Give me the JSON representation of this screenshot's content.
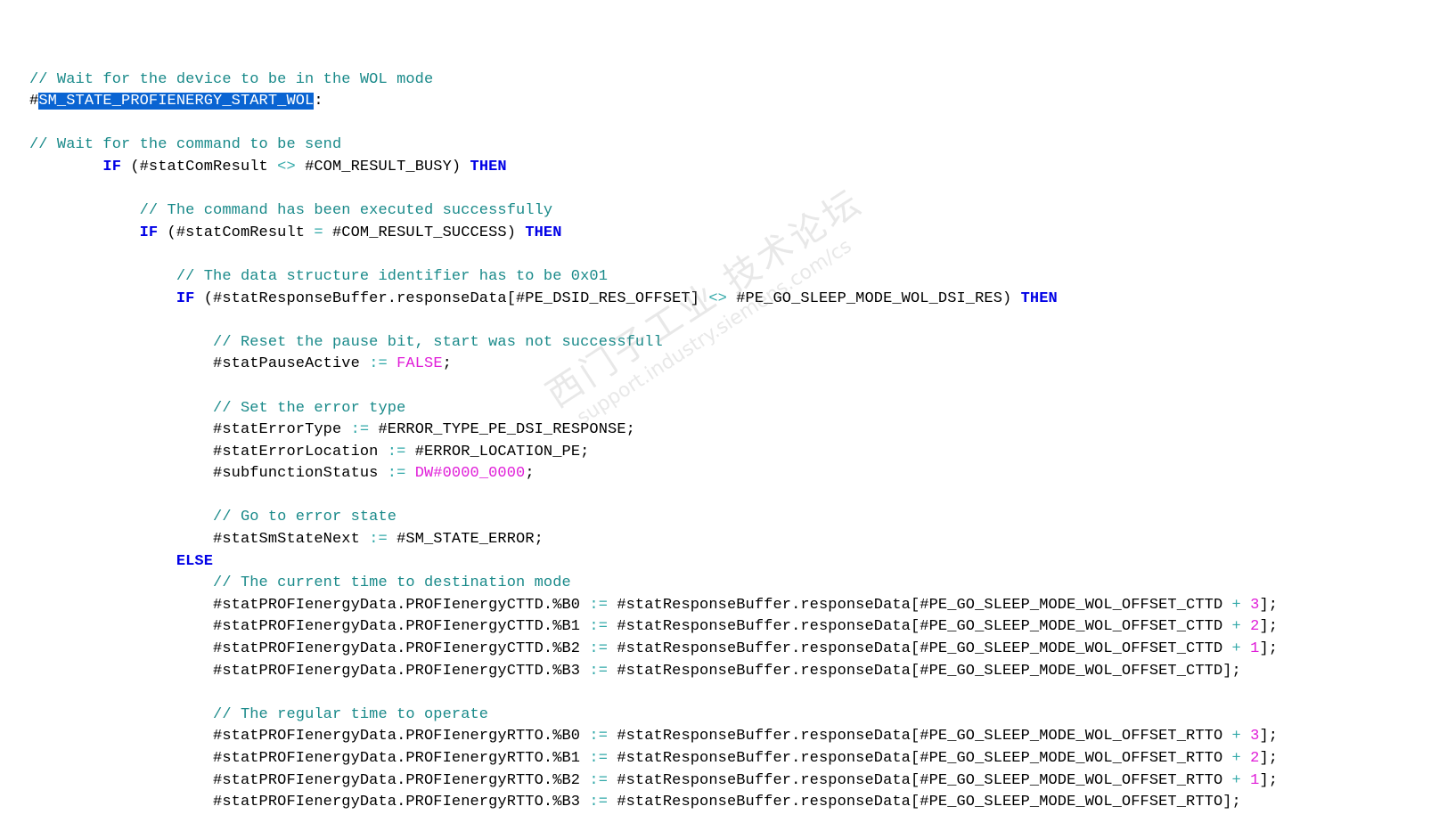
{
  "editor": {
    "lines": [
      {
        "indent": 0,
        "tokens": []
      },
      {
        "indent": 0,
        "tokens": [
          {
            "t": "// Wait for the device to be in the WOL mode",
            "c": "cm"
          }
        ]
      },
      {
        "indent": 0,
        "tokens": [
          {
            "t": "#",
            "c": "id"
          },
          {
            "t": "SM_STATE_PROFIENERGY_START_WOL",
            "c": "sel"
          },
          {
            "t": ":",
            "c": "id"
          }
        ]
      },
      {
        "indent": 0,
        "tokens": []
      },
      {
        "indent": 0,
        "tokens": [
          {
            "t": "// Wait for the command to be send",
            "c": "cm"
          }
        ]
      },
      {
        "indent": 8,
        "tokens": [
          {
            "t": "IF",
            "c": "kw"
          },
          {
            "t": " (#statComResult ",
            "c": "id"
          },
          {
            "t": "<>",
            "c": "op"
          },
          {
            "t": " #COM_RESULT_BUSY) ",
            "c": "id"
          },
          {
            "t": "THEN",
            "c": "kw"
          }
        ]
      },
      {
        "indent": 0,
        "tokens": []
      },
      {
        "indent": 12,
        "tokens": [
          {
            "t": "// The command has been executed successfully",
            "c": "cm"
          }
        ]
      },
      {
        "indent": 12,
        "tokens": [
          {
            "t": "IF",
            "c": "kw"
          },
          {
            "t": " (#statComResult ",
            "c": "id"
          },
          {
            "t": "=",
            "c": "op"
          },
          {
            "t": " #COM_RESULT_SUCCESS) ",
            "c": "id"
          },
          {
            "t": "THEN",
            "c": "kw"
          }
        ]
      },
      {
        "indent": 0,
        "tokens": []
      },
      {
        "indent": 16,
        "tokens": [
          {
            "t": "// The data structure identifier has to be 0x01",
            "c": "cm"
          }
        ]
      },
      {
        "indent": 16,
        "tokens": [
          {
            "t": "IF",
            "c": "kw"
          },
          {
            "t": " (#statResponseBuffer.responseData[#PE_DSID_RES_OFFSET] ",
            "c": "id"
          },
          {
            "t": "<>",
            "c": "op"
          },
          {
            "t": " #PE_GO_SLEEP_MODE_WOL_DSI_RES) ",
            "c": "id"
          },
          {
            "t": "THEN",
            "c": "kw"
          }
        ]
      },
      {
        "indent": 0,
        "tokens": []
      },
      {
        "indent": 20,
        "tokens": [
          {
            "t": "// Reset the pause bit, start was not successfull",
            "c": "cm"
          }
        ]
      },
      {
        "indent": 20,
        "tokens": [
          {
            "t": "#statPauseActive ",
            "c": "id"
          },
          {
            "t": ":=",
            "c": "op"
          },
          {
            "t": " ",
            "c": "id"
          },
          {
            "t": "FALSE",
            "c": "lit"
          },
          {
            "t": ";",
            "c": "id"
          }
        ]
      },
      {
        "indent": 0,
        "tokens": []
      },
      {
        "indent": 20,
        "tokens": [
          {
            "t": "// Set the error type",
            "c": "cm"
          }
        ]
      },
      {
        "indent": 20,
        "tokens": [
          {
            "t": "#statErrorType ",
            "c": "id"
          },
          {
            "t": ":=",
            "c": "op"
          },
          {
            "t": " #ERROR_TYPE_PE_DSI_RESPONSE;",
            "c": "id"
          }
        ]
      },
      {
        "indent": 20,
        "tokens": [
          {
            "t": "#statErrorLocation ",
            "c": "id"
          },
          {
            "t": ":=",
            "c": "op"
          },
          {
            "t": " #ERROR_LOCATION_PE;",
            "c": "id"
          }
        ]
      },
      {
        "indent": 20,
        "tokens": [
          {
            "t": "#subfunctionStatus ",
            "c": "id"
          },
          {
            "t": ":=",
            "c": "op"
          },
          {
            "t": " ",
            "c": "id"
          },
          {
            "t": "DW#0000_0000",
            "c": "lit"
          },
          {
            "t": ";",
            "c": "id"
          }
        ]
      },
      {
        "indent": 0,
        "tokens": []
      },
      {
        "indent": 20,
        "tokens": [
          {
            "t": "// Go to error state",
            "c": "cm"
          }
        ]
      },
      {
        "indent": 20,
        "tokens": [
          {
            "t": "#statSmStateNext ",
            "c": "id"
          },
          {
            "t": ":=",
            "c": "op"
          },
          {
            "t": " #SM_STATE_ERROR;",
            "c": "id"
          }
        ]
      },
      {
        "indent": 16,
        "tokens": [
          {
            "t": "ELSE",
            "c": "kw"
          }
        ]
      },
      {
        "indent": 20,
        "tokens": [
          {
            "t": "// The current time to destination mode",
            "c": "cm"
          }
        ]
      },
      {
        "indent": 20,
        "tokens": [
          {
            "t": "#statPROFIenergyData.PROFIenergyCTTD.%B0 ",
            "c": "id"
          },
          {
            "t": ":=",
            "c": "op"
          },
          {
            "t": " #statResponseBuffer.responseData[#PE_GO_SLEEP_MODE_WOL_OFFSET_CTTD ",
            "c": "id"
          },
          {
            "t": "+",
            "c": "op"
          },
          {
            "t": " ",
            "c": "id"
          },
          {
            "t": "3",
            "c": "lit"
          },
          {
            "t": "];",
            "c": "id"
          }
        ]
      },
      {
        "indent": 20,
        "tokens": [
          {
            "t": "#statPROFIenergyData.PROFIenergyCTTD.%B1 ",
            "c": "id"
          },
          {
            "t": ":=",
            "c": "op"
          },
          {
            "t": " #statResponseBuffer.responseData[#PE_GO_SLEEP_MODE_WOL_OFFSET_CTTD ",
            "c": "id"
          },
          {
            "t": "+",
            "c": "op"
          },
          {
            "t": " ",
            "c": "id"
          },
          {
            "t": "2",
            "c": "lit"
          },
          {
            "t": "];",
            "c": "id"
          }
        ]
      },
      {
        "indent": 20,
        "tokens": [
          {
            "t": "#statPROFIenergyData.PROFIenergyCTTD.%B2 ",
            "c": "id"
          },
          {
            "t": ":=",
            "c": "op"
          },
          {
            "t": " #statResponseBuffer.responseData[#PE_GO_SLEEP_MODE_WOL_OFFSET_CTTD ",
            "c": "id"
          },
          {
            "t": "+",
            "c": "op"
          },
          {
            "t": " ",
            "c": "id"
          },
          {
            "t": "1",
            "c": "lit"
          },
          {
            "t": "];",
            "c": "id"
          }
        ]
      },
      {
        "indent": 20,
        "tokens": [
          {
            "t": "#statPROFIenergyData.PROFIenergyCTTD.%B3 ",
            "c": "id"
          },
          {
            "t": ":=",
            "c": "op"
          },
          {
            "t": " #statResponseBuffer.responseData[#PE_GO_SLEEP_MODE_WOL_OFFSET_CTTD];",
            "c": "id"
          }
        ]
      },
      {
        "indent": 0,
        "tokens": []
      },
      {
        "indent": 20,
        "tokens": [
          {
            "t": "// The regular time to operate",
            "c": "cm"
          }
        ]
      },
      {
        "indent": 20,
        "tokens": [
          {
            "t": "#statPROFIenergyData.PROFIenergyRTTO.%B0 ",
            "c": "id"
          },
          {
            "t": ":=",
            "c": "op"
          },
          {
            "t": " #statResponseBuffer.responseData[#PE_GO_SLEEP_MODE_WOL_OFFSET_RTTO ",
            "c": "id"
          },
          {
            "t": "+",
            "c": "op"
          },
          {
            "t": " ",
            "c": "id"
          },
          {
            "t": "3",
            "c": "lit"
          },
          {
            "t": "];",
            "c": "id"
          }
        ]
      },
      {
        "indent": 20,
        "tokens": [
          {
            "t": "#statPROFIenergyData.PROFIenergyRTTO.%B1 ",
            "c": "id"
          },
          {
            "t": ":=",
            "c": "op"
          },
          {
            "t": " #statResponseBuffer.responseData[#PE_GO_SLEEP_MODE_WOL_OFFSET_RTTO ",
            "c": "id"
          },
          {
            "t": "+",
            "c": "op"
          },
          {
            "t": " ",
            "c": "id"
          },
          {
            "t": "2",
            "c": "lit"
          },
          {
            "t": "];",
            "c": "id"
          }
        ]
      },
      {
        "indent": 20,
        "tokens": [
          {
            "t": "#statPROFIenergyData.PROFIenergyRTTO.%B2 ",
            "c": "id"
          },
          {
            "t": ":=",
            "c": "op"
          },
          {
            "t": " #statResponseBuffer.responseData[#PE_GO_SLEEP_MODE_WOL_OFFSET_RTTO ",
            "c": "id"
          },
          {
            "t": "+",
            "c": "op"
          },
          {
            "t": " ",
            "c": "id"
          },
          {
            "t": "1",
            "c": "lit"
          },
          {
            "t": "];",
            "c": "id"
          }
        ]
      },
      {
        "indent": 20,
        "tokens": [
          {
            "t": "#statPROFIenergyData.PROFIenergyRTTO.%B3 ",
            "c": "id"
          },
          {
            "t": ":=",
            "c": "op"
          },
          {
            "t": " #statResponseBuffer.responseData[#PE_GO_SLEEP_MODE_WOL_OFFSET_RTTO];",
            "c": "id"
          }
        ]
      }
    ],
    "colors": {
      "keyword": "#0000e6",
      "comment": "#1a8a8a",
      "literal": "#e01ed8",
      "operator": "#33a9a9",
      "selection": "#0a64d2"
    }
  },
  "watermark": {
    "line1": "西门子工业 技术论坛",
    "line2": "support.industry.siemens.com/cs"
  }
}
